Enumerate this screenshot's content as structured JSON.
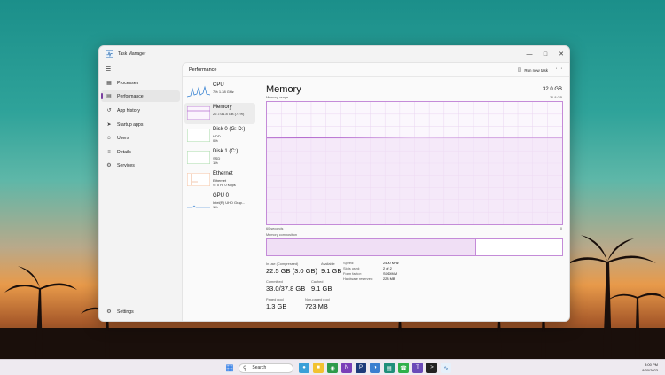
{
  "window": {
    "title": "Task Manager"
  },
  "nav": {
    "items": [
      {
        "label": "Processes",
        "icon": "grid-icon"
      },
      {
        "label": "Performance",
        "icon": "pulse-icon",
        "active": true
      },
      {
        "label": "App history",
        "icon": "history-icon"
      },
      {
        "label": "Startup apps",
        "icon": "rocket-icon"
      },
      {
        "label": "Users",
        "icon": "users-icon"
      },
      {
        "label": "Details",
        "icon": "list-icon"
      },
      {
        "label": "Services",
        "icon": "gear-icon"
      }
    ],
    "settings": "Settings"
  },
  "header": {
    "title": "Performance",
    "run_task": "Run new task"
  },
  "devices": [
    {
      "name": "CPU",
      "sub": "7%  1.38 GHz"
    },
    {
      "name": "Memory",
      "sub": "22.7/31.8 GB (71%)",
      "active": true
    },
    {
      "name": "Disk 0 (G: D:)",
      "sub": "HDD\n0%"
    },
    {
      "name": "Disk 1 (C:)",
      "sub": "SSD\n1%"
    },
    {
      "name": "Ethernet",
      "sub": "Ethernet\nS: 0 R: 0 Kbps"
    },
    {
      "name": "GPU 0",
      "sub": "Intel(R) UHD Grap...\n1%"
    }
  ],
  "detail": {
    "title": "Memory",
    "total": "32.0 GB",
    "usage_label": "Memory usage",
    "usage_max": "31.8 GB",
    "graph_left": "60 seconds",
    "graph_right": "0",
    "composition_label": "Memory composition",
    "composition_used_fraction": 0.71,
    "usage_fraction": 0.71,
    "stats": {
      "in_use_label": "In use (Compressed)",
      "in_use": "22.5 GB (3.0 GB)",
      "available_label": "Available",
      "available": "9.1 GB",
      "committed_label": "Committed",
      "committed": "33.0/37.8 GB",
      "cached_label": "Cached",
      "cached": "9.1 GB",
      "paged_label": "Paged pool",
      "paged": "1.3 GB",
      "nonpaged_label": "Non-paged pool",
      "nonpaged": "723 MB"
    },
    "specs": [
      {
        "k": "Speed:",
        "v": "2400 MHz"
      },
      {
        "k": "Slots used:",
        "v": "2 of 2"
      },
      {
        "k": "Form factor:",
        "v": "SODIMM"
      },
      {
        "k": "Hardware reserved:",
        "v": "228 MB"
      }
    ]
  },
  "taskbar": {
    "search": "Search",
    "time": "3:00 PM",
    "date": "8/30/2023"
  },
  "colors": {
    "accent": "#7a3fa0",
    "memory_line": "#b66fd0",
    "memory_fill": "#f0dff5"
  }
}
